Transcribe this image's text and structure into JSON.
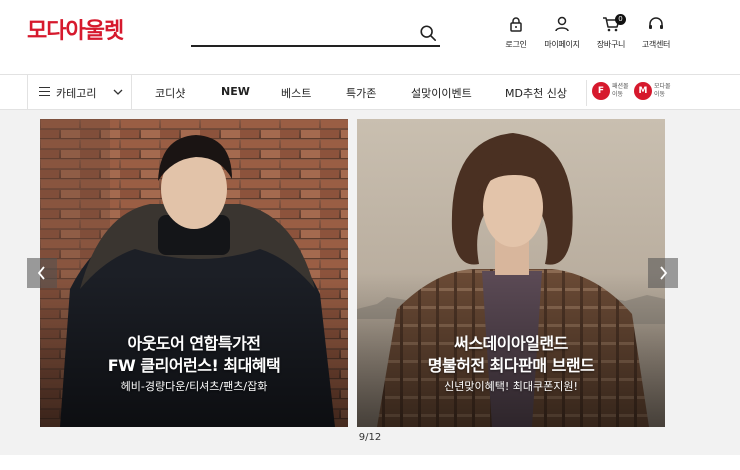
{
  "logo": {
    "prefix": "모다",
    "suffix": "아울렛"
  },
  "search": {
    "value": "",
    "placeholder": ""
  },
  "utils": {
    "login": "로그인",
    "mypage": "마이페이지",
    "cart": "장바구니",
    "cart_count": "0",
    "support": "고객센터"
  },
  "nav": {
    "category": "카테고리",
    "items": [
      "코디샷",
      "NEW",
      "베스트",
      "특가존",
      "설맞이이벤트",
      "MD추천 신상"
    ],
    "promos": [
      {
        "letter": "F",
        "line1": "패션몰",
        "line2": "이동"
      },
      {
        "letter": "M",
        "line1": "모다몰",
        "line2": "이동"
      }
    ]
  },
  "carousel": {
    "banners": [
      {
        "title1": "아웃도어 연합특가전",
        "title2": "FW 클리어런스! 최대혜택",
        "subtitle": "헤비-경량다운/티셔츠/팬츠/잡화"
      },
      {
        "title1": "써스데이아일랜드",
        "title2": "명불허전 최다판매 브랜드",
        "subtitle": "신년맞이혜택! 최대쿠폰지원!"
      }
    ],
    "pager": "9/12"
  },
  "colors": {
    "brand": "#d6192d"
  }
}
